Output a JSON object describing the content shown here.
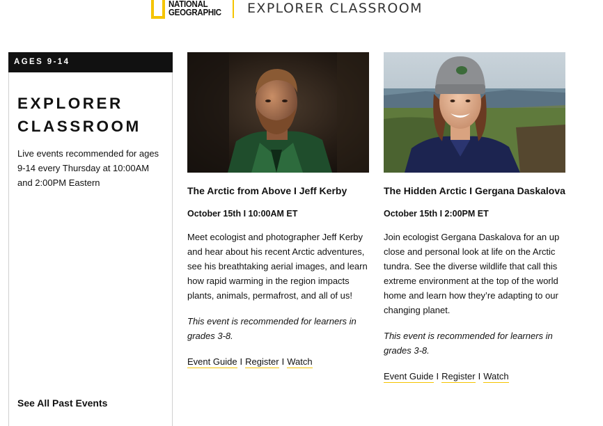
{
  "header": {
    "logo_line1": "NATIONAL",
    "logo_line2": "GEOGRAPHIC",
    "title": "EXPLORER CLASSROOM",
    "brand_color": "#f5c400"
  },
  "sidebar": {
    "age_badge": "AGES 9-14",
    "title_line1": "EXPLORER",
    "title_line2": "CLASSROOM",
    "description": "Live events recommended for ages 9-14 every Thursday at 10:00AM and 2:00PM Eastern",
    "past_events_link": "See All Past Events"
  },
  "events": [
    {
      "title": "The Arctic from Above I Jeff Kerby",
      "date": "October 15th I 10:00AM ET",
      "description": "Meet ecologist and photographer Jeff Kerby and hear about his recent Arctic adventures, see his breathtaking aerial images, and learn how rapid warming in the region impacts plants, animals, permafrost, and all of us!",
      "note": "This event is recommended for learners in grades 3-8.",
      "links": {
        "guide": "Event Guide",
        "register": "Register",
        "watch": "Watch",
        "separator": "I"
      }
    },
    {
      "title": "The Hidden Arctic I Gergana Daskalova",
      "date": "October 15th I 2:00PM ET",
      "description": "Join ecologist Gergana Daskalova for an up close and personal look at life on the Arctic tundra. See the diverse wildlife that call this extreme environment at the top of the world home and learn how they’re adapting to our changing planet.",
      "note": "This event is recommended for learners in grades 3-8.",
      "links": {
        "guide": "Event Guide",
        "register": "Register",
        "watch": "Watch",
        "separator": "I"
      }
    }
  ]
}
